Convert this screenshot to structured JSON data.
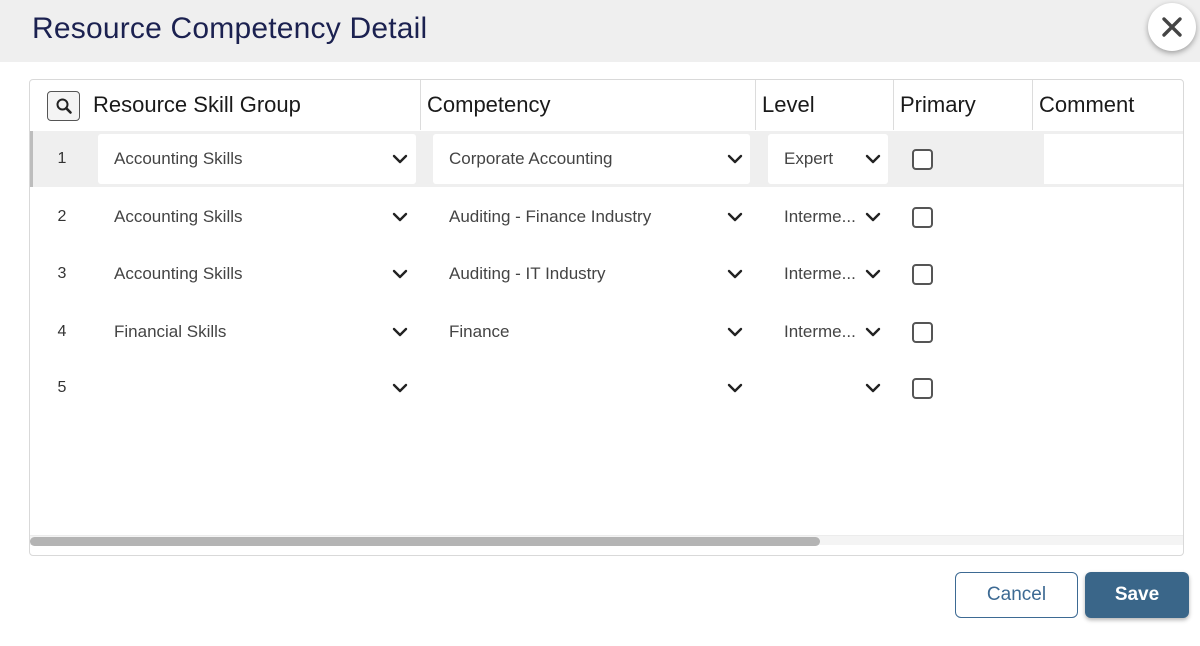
{
  "dialog": {
    "title": "Resource Competency Detail",
    "close_icon": "close-icon"
  },
  "grid": {
    "columns": [
      "Resource Skill Group",
      "Competency",
      "Level",
      "Primary",
      "Comment"
    ],
    "rows": [
      {
        "num": "1",
        "skill_group": "Accounting Skills",
        "competency": "Corporate Accounting",
        "level": "Expert",
        "primary": false,
        "comment": ""
      },
      {
        "num": "2",
        "skill_group": "Accounting Skills",
        "competency": "Auditing - Finance Industry",
        "level": "Interme...",
        "primary": false,
        "comment": ""
      },
      {
        "num": "3",
        "skill_group": "Accounting Skills",
        "competency": "Auditing - IT Industry",
        "level": "Interme...",
        "primary": false,
        "comment": ""
      },
      {
        "num": "4",
        "skill_group": "Financial Skills",
        "competency": "Finance",
        "level": "Interme...",
        "primary": false,
        "comment": ""
      },
      {
        "num": "5",
        "skill_group": "",
        "competency": "",
        "level": "",
        "primary": false,
        "comment": ""
      }
    ]
  },
  "buttons": {
    "cancel": "Cancel",
    "save": "Save"
  },
  "colors": {
    "title": "#1b2150",
    "accent": "#3a6689"
  }
}
